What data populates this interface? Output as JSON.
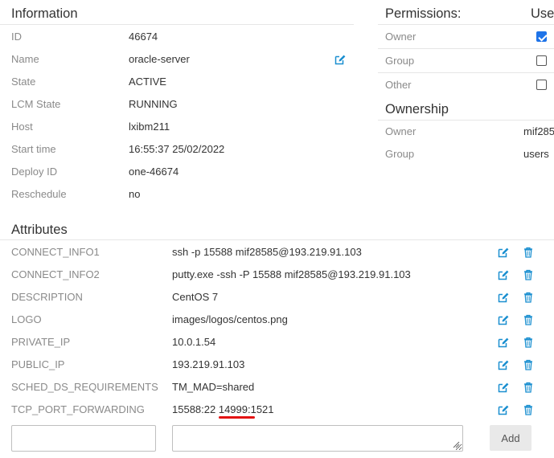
{
  "information": {
    "title": "Information",
    "rows": [
      {
        "label": "ID",
        "value": "46674"
      },
      {
        "label": "Name",
        "value": "oracle-server"
      },
      {
        "label": "State",
        "value": "ACTIVE"
      },
      {
        "label": "LCM State",
        "value": "RUNNING"
      },
      {
        "label": "Host",
        "value": "lxibm211"
      },
      {
        "label": "Start time",
        "value": "16:55:37 25/02/2022"
      },
      {
        "label": "Deploy ID",
        "value": "one-46674"
      },
      {
        "label": "Reschedule",
        "value": "no"
      }
    ],
    "edit_icon": "pencil-square-icon"
  },
  "permissions": {
    "title": "Permissions:",
    "column_header": "Use",
    "rows": [
      {
        "label": "Owner",
        "checked": true
      },
      {
        "label": "Group",
        "checked": false
      },
      {
        "label": "Other",
        "checked": false
      }
    ]
  },
  "ownership": {
    "title": "Ownership",
    "rows": [
      {
        "label": "Owner",
        "value": "mif285"
      },
      {
        "label": "Group",
        "value": "users"
      }
    ]
  },
  "attributes": {
    "title": "Attributes",
    "rows": [
      {
        "key": "CONNECT_INFO1",
        "value": "ssh -p 15588 mif28585@193.219.91.103"
      },
      {
        "key": "CONNECT_INFO2",
        "value": "putty.exe -ssh -P 15588 mif28585@193.219.91.103"
      },
      {
        "key": "DESCRIPTION",
        "value": "CentOS 7"
      },
      {
        "key": "LOGO",
        "value": "images/logos/centos.png"
      },
      {
        "key": "PRIVATE_IP",
        "value": "10.0.1.54"
      },
      {
        "key": "PUBLIC_IP",
        "value": "193.219.91.103"
      },
      {
        "key": "SCHED_DS_REQUIREMENTS",
        "value": "TM_MAD=shared"
      },
      {
        "key": "TCP_PORT_FORWARDING",
        "value": "15588:22 14999:1521"
      }
    ],
    "edit_icon": "pencil-square-icon",
    "delete_icon": "trash-icon",
    "new_key_value": "",
    "new_value_value": "",
    "add_label": "Add"
  },
  "colors": {
    "accent": "#1a8fd0",
    "checkbox_checked": "#1e73e8",
    "annotation_underline": "#e31313"
  }
}
